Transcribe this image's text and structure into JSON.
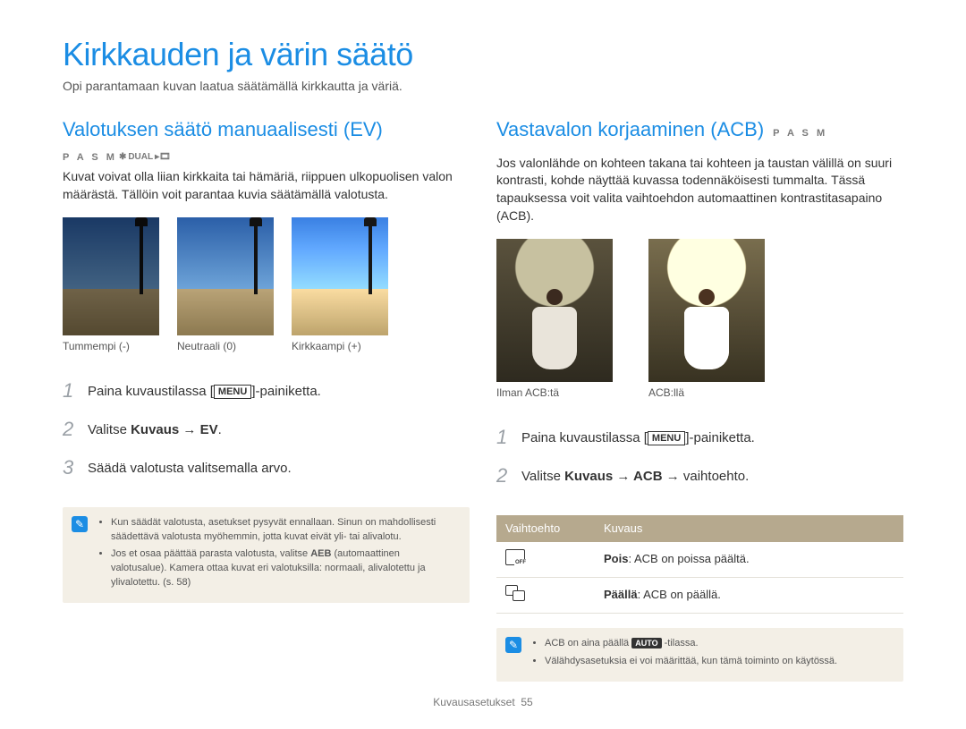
{
  "page": {
    "title": "Kirkkauden ja värin säätö",
    "intro": "Opi parantamaan kuvan laatua säätämällä kirkkautta ja väriä."
  },
  "left": {
    "heading": "Valotuksen säätö manuaalisesti (EV)",
    "modes": "P A S M",
    "modes_suffix_dual": "DUAL",
    "body": "Kuvat voivat olla liian kirkkaita tai hämäriä, riippuen ulkopuolisen valon määrästä. Tällöin voit parantaa kuvia säätämällä valotusta.",
    "thumbs": [
      {
        "label": "Tummempi (-)"
      },
      {
        "label": "Neutraali (0)"
      },
      {
        "label": "Kirkkaampi (+)"
      }
    ],
    "steps": {
      "s1_pre": "Paina kuvaustilassa [",
      "s1_menu": "MENU",
      "s1_post": "]-painiketta.",
      "s2_pre": "Valitse ",
      "s2_bold": "Kuvaus → EV",
      "s2_post": ".",
      "s3": "Säädä valotusta valitsemalla arvo."
    },
    "note": {
      "b1": "Kun säädät valotusta, asetukset pysyvät ennallaan. Sinun on mahdollisesti säädettävä valotusta myöhemmin, jotta kuvat eivät yli- tai alivalotu.",
      "b2_pre": "Jos et osaa päättää parasta valotusta, valitse ",
      "b2_bold": "AEB",
      "b2_post": " (automaattinen valotusalue). Kamera ottaa kuvat eri valotuksilla: normaali, alivalotettu ja ylivalotettu. (s. 58)"
    }
  },
  "right": {
    "heading": "Vastavalon korjaaminen (ACB)",
    "modes": "P A S M",
    "body": "Jos valonlähde on kohteen takana tai kohteen ja taustan välillä on suuri kontrasti, kohde näyttää kuvassa todennäköisesti tummalta. Tässä tapauksessa voit valita vaihtoehdon automaattinen kontrastitasapaino (ACB).",
    "thumbs": [
      {
        "label": "Ilman ACB:tä"
      },
      {
        "label": "ACB:llä"
      }
    ],
    "steps": {
      "s1_pre": "Paina kuvaustilassa [",
      "s1_menu": "MENU",
      "s1_post": "]-painiketta.",
      "s2_pre": "Valitse ",
      "s2_bold": "Kuvaus → ACB",
      "s2_post": " → vaihtoehto."
    },
    "table": {
      "h1": "Vaihtoehto",
      "h2": "Kuvaus",
      "r1_bold": "Pois",
      "r1_rest": ": ACB on poissa päältä.",
      "r2_bold": "Päällä",
      "r2_rest": ": ACB on päällä."
    },
    "note": {
      "b1_pre": "ACB on aina päällä ",
      "b1_auto": "AUTO",
      "b1_post": " -tilassa.",
      "b2": "Välähdysasetuksia ei voi määrittää, kun tämä toiminto on käytössä."
    }
  },
  "footer": {
    "section": "Kuvausasetukset",
    "page_no": "55"
  }
}
